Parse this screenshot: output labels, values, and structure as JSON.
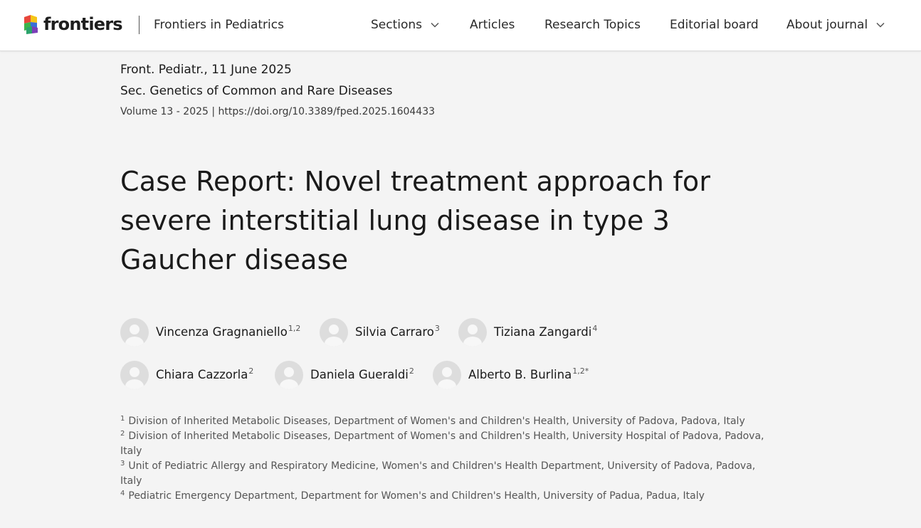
{
  "header": {
    "logo_text": "frontiers",
    "journal_name": "Frontiers in Pediatrics",
    "nav": [
      {
        "label": "Sections",
        "has_dropdown": true
      },
      {
        "label": "Articles",
        "has_dropdown": false
      },
      {
        "label": "Research Topics",
        "has_dropdown": false
      },
      {
        "label": "Editorial board",
        "has_dropdown": false
      },
      {
        "label": "About journal",
        "has_dropdown": true
      }
    ]
  },
  "article": {
    "journal_date": "Front. Pediatr., 11 June 2025",
    "section": "Sec. Genetics of Common and Rare Diseases",
    "volume": "Volume 13 - 2025",
    "separator": "|",
    "doi": "https://doi.org/10.3389/fped.2025.1604433",
    "title": "Case Report: Novel treatment approach for severe interstitial lung disease in type 3 Gaucher disease",
    "authors": [
      {
        "name": "Vincenza Gragnaniello",
        "affil": "1,2"
      },
      {
        "name": "Silvia Carraro",
        "affil": "3"
      },
      {
        "name": "Tiziana Zangardi",
        "affil": "4"
      },
      {
        "name": "Chiara Cazzorla",
        "affil": "2"
      },
      {
        "name": "Daniela Gueraldi",
        "affil": "2"
      },
      {
        "name": "Alberto B. Burlina",
        "affil": "1,2*"
      }
    ],
    "affiliations": [
      {
        "num": "1",
        "text": "Division of Inherited Metabolic Diseases, Department of Women's and Children's Health, University of Padova, Padova, Italy"
      },
      {
        "num": "2",
        "text": "Division of Inherited Metabolic Diseases, Department of Women's and Children's Health, University Hospital of Padova, Padova, Italy"
      },
      {
        "num": "3",
        "text": "Unit of Pediatric Allergy and Respiratory Medicine, Women's and Children's Health Department, University of Padova, Padova, Italy"
      },
      {
        "num": "4",
        "text": "Pediatric Emergency Department, Department for Women's and Children's Health, University of Padua, Padua, Italy"
      }
    ]
  },
  "icons": {
    "logo": "frontiers-logo-icon",
    "dropdown": "chevron-down-icon",
    "avatar": "user-avatar-icon"
  },
  "colors": {
    "background": "#f4f4f4",
    "header_bg": "#ffffff",
    "avatar_bg": "#dddddd",
    "logo_red": "#e8473b",
    "logo_yellow": "#f5c518",
    "logo_blue": "#3a6fd8",
    "logo_green": "#3bb34a"
  }
}
